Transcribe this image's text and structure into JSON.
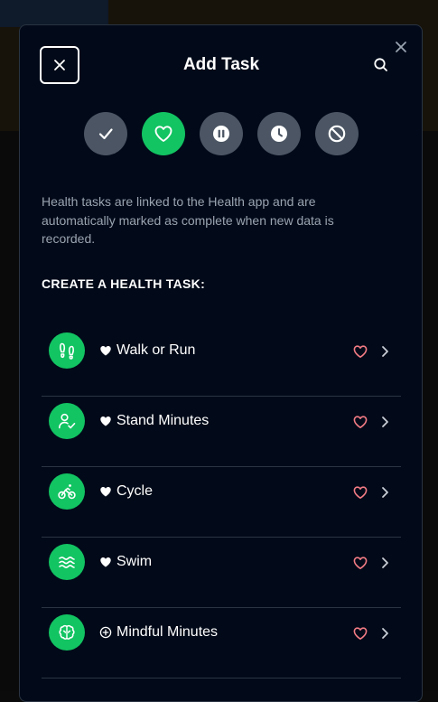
{
  "modal": {
    "title": "Add Task",
    "description": "Health tasks are linked to the Health app and are automatically marked as complete when new data is recorded.",
    "section_heading": "CREATE A HEALTH TASK:"
  },
  "task_types": [
    {
      "icon": "check-icon",
      "active": false
    },
    {
      "icon": "heart-icon",
      "active": true
    },
    {
      "icon": "pause-icon",
      "active": false
    },
    {
      "icon": "clock-icon",
      "active": false
    },
    {
      "icon": "block-icon",
      "active": false
    }
  ],
  "tasks": [
    {
      "label": "Walk or Run",
      "lead_icon": "heart-filled-icon",
      "icon": "footprints-icon"
    },
    {
      "label": "Stand Minutes",
      "lead_icon": "heart-filled-icon",
      "icon": "person-check-icon"
    },
    {
      "label": "Cycle",
      "lead_icon": "heart-filled-icon",
      "icon": "bike-icon"
    },
    {
      "label": "Swim",
      "lead_icon": "heart-filled-icon",
      "icon": "waves-icon"
    },
    {
      "label": "Mindful Minutes",
      "lead_icon": "plus-circle-icon",
      "icon": "brain-icon"
    }
  ],
  "colors": {
    "accent": "#12c462",
    "modal_bg": "#020a19",
    "muted_text": "#9aa3b0",
    "heart_outline": "#f47c85",
    "inactive_circle": "#4b5563"
  }
}
